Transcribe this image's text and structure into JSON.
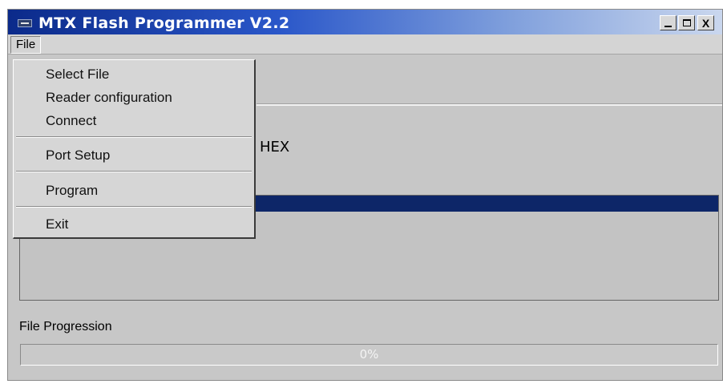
{
  "window": {
    "title": "MTX Flash Programmer V2.2",
    "controls": {
      "minimize": "_",
      "maximize": "□",
      "close": "X"
    }
  },
  "menubar": {
    "file_label": "File"
  },
  "file_menu": {
    "items": [
      {
        "label": "Select File"
      },
      {
        "label": "Reader configuration"
      },
      {
        "label": "Connect"
      },
      {
        "label": "Port Setup"
      },
      {
        "label": "Program"
      },
      {
        "label": "Exit"
      }
    ]
  },
  "main": {
    "file_type_partial": "HEX",
    "progress_label": "File Progression",
    "progress_value_text": "0%",
    "progress_value": 0
  },
  "colors": {
    "selection": "#0d2668",
    "window_bg": "#c7c7c7",
    "titlebar_start": "#0b2a8a"
  }
}
